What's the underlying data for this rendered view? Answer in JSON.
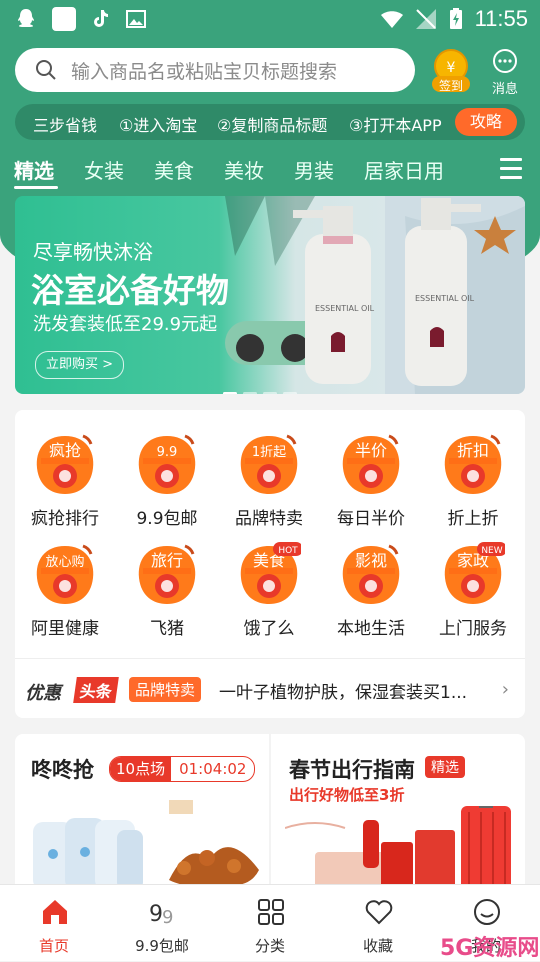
{
  "status_bar": {
    "time": "11:55"
  },
  "search": {
    "placeholder": "输入商品名或粘贴宝贝标题搜索"
  },
  "signin": {
    "label": "签到"
  },
  "message": {
    "label": "消息"
  },
  "steps": {
    "title": "三步省钱",
    "step1": "①进入淘宝",
    "step2": "②复制商品标题",
    "step3": "③打开本APP",
    "guide": "攻略"
  },
  "categories": [
    "精选",
    "女装",
    "美食",
    "美妆",
    "男装",
    "居家日用"
  ],
  "banner": {
    "line1": "尽享畅快沐浴",
    "line2": "浴室必备好物",
    "line3": "洗发套装低至29.9元起",
    "button": "立即购买 >",
    "product_text": "ESSENTIAL OIL"
  },
  "features": [
    {
      "badge": "疯抢",
      "label": "疯抢排行",
      "icon": "fire-icon"
    },
    {
      "badge": "9.9",
      "label": "9.9包邮",
      "icon": "gift-icon"
    },
    {
      "badge": "1折起",
      "label": "品牌特卖",
      "icon": "crown-icon"
    },
    {
      "badge": "半价",
      "label": "每日半价",
      "icon": "yen-icon"
    },
    {
      "badge": "折扣",
      "label": "折上折",
      "icon": "tag-icon"
    },
    {
      "badge": "放心购",
      "label": "阿里健康",
      "icon": "heart-pulse-icon"
    },
    {
      "badge": "旅行",
      "label": "飞猪",
      "icon": "pig-icon"
    },
    {
      "badge": "美食",
      "label": "饿了么",
      "icon": "eleme-icon",
      "corner": "HOT"
    },
    {
      "badge": "影视",
      "label": "本地生活",
      "icon": "camera-icon"
    },
    {
      "badge": "家政",
      "label": "上门服务",
      "icon": "cat-icon",
      "corner": "NEW"
    }
  ],
  "news": {
    "brand": "优惠",
    "brand_tag": "头条",
    "tag": "品牌特卖",
    "text": "一叶子植物护肤，保湿套装买1..."
  },
  "flash_sale": {
    "title": "咚咚抢",
    "session": "10点场",
    "countdown": "01:04:02"
  },
  "travel": {
    "title": "春节出行指南",
    "badge": "精选",
    "subtitle": "出行好物低至3折"
  },
  "tabs": [
    {
      "label": "首页",
      "icon": "home-icon",
      "active": true
    },
    {
      "label": "9.9包邮",
      "icon": "nine-nine-icon",
      "active": false
    },
    {
      "label": "分类",
      "icon": "grid-icon",
      "active": false
    },
    {
      "label": "收藏",
      "icon": "heart-icon",
      "active": false
    },
    {
      "label": "我的",
      "icon": "smile-icon",
      "active": false
    }
  ],
  "watermark": "5G资源网",
  "colors": {
    "brand_green": "#3aa37c",
    "accent_red": "#e8392a",
    "accent_orange": "#ff6a2a"
  }
}
